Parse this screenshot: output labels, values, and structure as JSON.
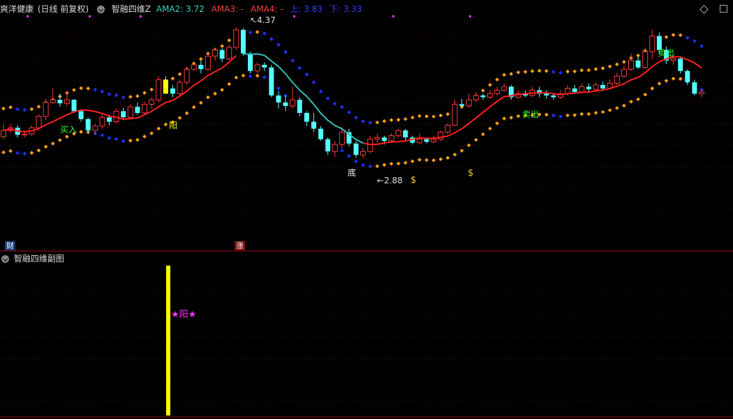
{
  "header": {
    "stock": "爽洋健康",
    "mode": "(日线 前复权)",
    "indicator": "智融四维Z",
    "ama2": "AMA2: 3.72",
    "ama3": "AMA3: -",
    "ama4": "AMA4: -",
    "up": "上: 3.83",
    "down": "下: 3.33"
  },
  "sub": {
    "title": "智融四维副图",
    "signal": "★阳★"
  },
  "labels": {
    "high": "4.37",
    "low": "2.88",
    "yang": "阳",
    "di": "底",
    "maichu1": "卖出",
    "maichu2": "卖出",
    "buy": "买入",
    "cai": "财",
    "zhang": "涨"
  },
  "colors": {
    "up": "#ff3b3b",
    "down": "#54ffff",
    "ma": "#ff2020",
    "ma2": "#33c0b8",
    "orange": "#ff9f1a",
    "blue": "#2030ff",
    "yellow": "#ffff00",
    "magenta": "#ff33ff"
  },
  "chart_data": {
    "type": "candlestick",
    "ylim": [
      2.3,
      4.5
    ],
    "highest": 4.37,
    "lowest": 2.88,
    "candles": [
      [
        3.13,
        3.2,
        3.27,
        3.1
      ],
      [
        3.2,
        3.23,
        3.27,
        3.17
      ],
      [
        3.23,
        3.15,
        3.26,
        3.12
      ],
      [
        3.15,
        3.16,
        3.2,
        3.12
      ],
      [
        3.16,
        3.23,
        3.26,
        3.14
      ],
      [
        3.23,
        3.36,
        3.38,
        3.2
      ],
      [
        3.36,
        3.52,
        3.56,
        3.32
      ],
      [
        3.52,
        3.55,
        3.68,
        3.5
      ],
      [
        3.55,
        3.51,
        3.62,
        3.47
      ],
      [
        3.51,
        3.55,
        3.65,
        3.48
      ],
      [
        3.55,
        3.42,
        3.56,
        3.4
      ],
      [
        3.42,
        3.33,
        3.44,
        3.3
      ],
      [
        3.33,
        3.2,
        3.35,
        3.18
      ],
      [
        3.2,
        3.25,
        3.28,
        3.15
      ],
      [
        3.25,
        3.35,
        3.38,
        3.22
      ],
      [
        3.35,
        3.3,
        3.38,
        3.26
      ],
      [
        3.3,
        3.42,
        3.45,
        3.28
      ],
      [
        3.42,
        3.35,
        3.46,
        3.32
      ],
      [
        3.35,
        3.47,
        3.5,
        3.33
      ],
      [
        3.47,
        3.4,
        3.52,
        3.38
      ],
      [
        3.4,
        3.5,
        3.53,
        3.38
      ],
      [
        3.5,
        3.55,
        3.58,
        3.45
      ],
      [
        3.55,
        3.78,
        3.82,
        3.52
      ],
      [
        3.78,
        3.68,
        3.82,
        3.62
      ],
      [
        3.68,
        3.62,
        3.72,
        3.58
      ],
      [
        3.62,
        3.75,
        3.78,
        3.6
      ],
      [
        3.75,
        3.9,
        3.93,
        3.72
      ],
      [
        3.9,
        3.95,
        3.98,
        3.88
      ],
      [
        3.95,
        3.9,
        4.0,
        3.85
      ],
      [
        3.9,
        4.05,
        4.08,
        3.88
      ],
      [
        4.05,
        4.12,
        4.15,
        4.0
      ],
      [
        4.12,
        4.02,
        4.14,
        3.98
      ],
      [
        4.02,
        4.15,
        4.18,
        4.0
      ],
      [
        4.15,
        4.35,
        4.38,
        4.12
      ],
      [
        4.35,
        4.08,
        4.37,
        4.05
      ],
      [
        4.08,
        3.88,
        4.1,
        3.85
      ],
      [
        3.88,
        3.95,
        3.98,
        3.85
      ],
      [
        3.95,
        3.92,
        3.98,
        3.88
      ],
      [
        3.92,
        3.6,
        3.95,
        3.58
      ],
      [
        3.6,
        3.52,
        3.65,
        3.45
      ],
      [
        3.52,
        3.48,
        3.6,
        3.42
      ],
      [
        3.48,
        3.55,
        3.7,
        3.45
      ],
      [
        3.55,
        3.4,
        3.58,
        3.36
      ],
      [
        3.4,
        3.3,
        3.42,
        3.25
      ],
      [
        3.3,
        3.22,
        3.4,
        3.18
      ],
      [
        3.22,
        3.1,
        3.25,
        3.08
      ],
      [
        3.1,
        2.96,
        3.12,
        2.92
      ],
      [
        2.96,
        3.04,
        3.08,
        2.9
      ],
      [
        3.04,
        3.18,
        3.24,
        3.0
      ],
      [
        3.18,
        3.05,
        3.22,
        3.02
      ],
      [
        3.05,
        2.92,
        3.08,
        2.89
      ],
      [
        2.92,
        2.96,
        3.0,
        2.88
      ],
      [
        2.96,
        3.1,
        3.14,
        2.94
      ],
      [
        3.1,
        3.12,
        3.16,
        3.06
      ],
      [
        3.12,
        3.08,
        3.14,
        3.04
      ],
      [
        3.08,
        3.14,
        3.17,
        3.06
      ],
      [
        3.14,
        3.2,
        3.22,
        3.12
      ],
      [
        3.2,
        3.12,
        3.22,
        3.08
      ],
      [
        3.12,
        3.06,
        3.14,
        3.04
      ],
      [
        3.06,
        3.1,
        3.16,
        3.04
      ],
      [
        3.1,
        3.07,
        3.12,
        3.05
      ],
      [
        3.07,
        3.1,
        3.14,
        3.05
      ],
      [
        3.1,
        3.18,
        3.2,
        3.08
      ],
      [
        3.18,
        3.26,
        3.28,
        3.16
      ],
      [
        3.26,
        3.5,
        3.55,
        3.25
      ],
      [
        3.5,
        3.48,
        3.56,
        3.45
      ],
      [
        3.48,
        3.55,
        3.62,
        3.46
      ],
      [
        3.55,
        3.6,
        3.64,
        3.52
      ],
      [
        3.6,
        3.58,
        3.62,
        3.55
      ],
      [
        3.58,
        3.62,
        3.66,
        3.56
      ],
      [
        3.62,
        3.66,
        3.7,
        3.6
      ],
      [
        3.66,
        3.7,
        3.74,
        3.64
      ],
      [
        3.7,
        3.58,
        3.72,
        3.55
      ],
      [
        3.58,
        3.62,
        3.66,
        3.56
      ],
      [
        3.62,
        3.6,
        3.66,
        3.58
      ],
      [
        3.6,
        3.66,
        3.7,
        3.58
      ],
      [
        3.66,
        3.62,
        3.7,
        3.58
      ],
      [
        3.62,
        3.6,
        3.66,
        3.56
      ],
      [
        3.6,
        3.58,
        3.62,
        3.55
      ],
      [
        3.58,
        3.62,
        3.66,
        3.56
      ],
      [
        3.62,
        3.68,
        3.72,
        3.6
      ],
      [
        3.68,
        3.64,
        3.72,
        3.62
      ],
      [
        3.64,
        3.7,
        3.74,
        3.62
      ],
      [
        3.7,
        3.67,
        3.74,
        3.64
      ],
      [
        3.67,
        3.72,
        3.75,
        3.64
      ],
      [
        3.72,
        3.68,
        3.76,
        3.65
      ],
      [
        3.68,
        3.74,
        3.78,
        3.66
      ],
      [
        3.74,
        3.82,
        3.86,
        3.72
      ],
      [
        3.82,
        3.9,
        3.94,
        3.8
      ],
      [
        3.9,
        4.0,
        4.08,
        3.88
      ],
      [
        4.0,
        3.92,
        4.04,
        3.9
      ],
      [
        3.92,
        4.1,
        4.14,
        3.9
      ],
      [
        4.1,
        4.28,
        4.35,
        4.02
      ],
      [
        4.28,
        4.12,
        4.32,
        4.08
      ],
      [
        4.12,
        4.0,
        4.16,
        3.96
      ],
      [
        4.0,
        4.02,
        4.05,
        3.95
      ],
      [
        4.02,
        3.88,
        4.05,
        3.85
      ],
      [
        3.88,
        3.75,
        3.9,
        3.72
      ],
      [
        3.75,
        3.62,
        3.78,
        3.6
      ],
      [
        3.62,
        3.64,
        3.68,
        3.58
      ]
    ],
    "ma2": [
      {
        "from": 0,
        "to": 33,
        "color": "ma"
      },
      {
        "from": 34,
        "to": 51,
        "color": "ma2"
      },
      {
        "from": 51,
        "to": 99,
        "color": "ma"
      }
    ]
  }
}
